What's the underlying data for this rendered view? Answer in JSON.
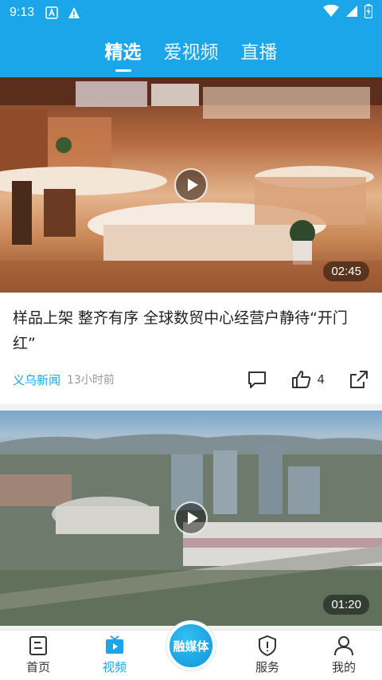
{
  "status_bar": {
    "time": "9:13"
  },
  "header": {
    "tabs": [
      {
        "label": "精选",
        "active": true
      },
      {
        "label": "爱视频",
        "active": false
      },
      {
        "label": "直播",
        "active": false
      }
    ],
    "accent_color": "#1aa6e8"
  },
  "feed": [
    {
      "duration": "02:45",
      "title": "样品上架 整齐有序  全球数贸中心经营户静待“开门红”",
      "source": "义乌新闻",
      "time_ago": "13小时前",
      "likes": "4"
    },
    {
      "duration": "01:20"
    }
  ],
  "bottom_nav": {
    "items": [
      {
        "label": "首页",
        "icon": "home-doc-icon"
      },
      {
        "label": "视频",
        "icon": "tv-icon",
        "active": true
      },
      {
        "label": "服务",
        "icon": "shield-icon"
      },
      {
        "label": "我的",
        "icon": "person-icon"
      }
    ],
    "center_label": "融媒体"
  }
}
